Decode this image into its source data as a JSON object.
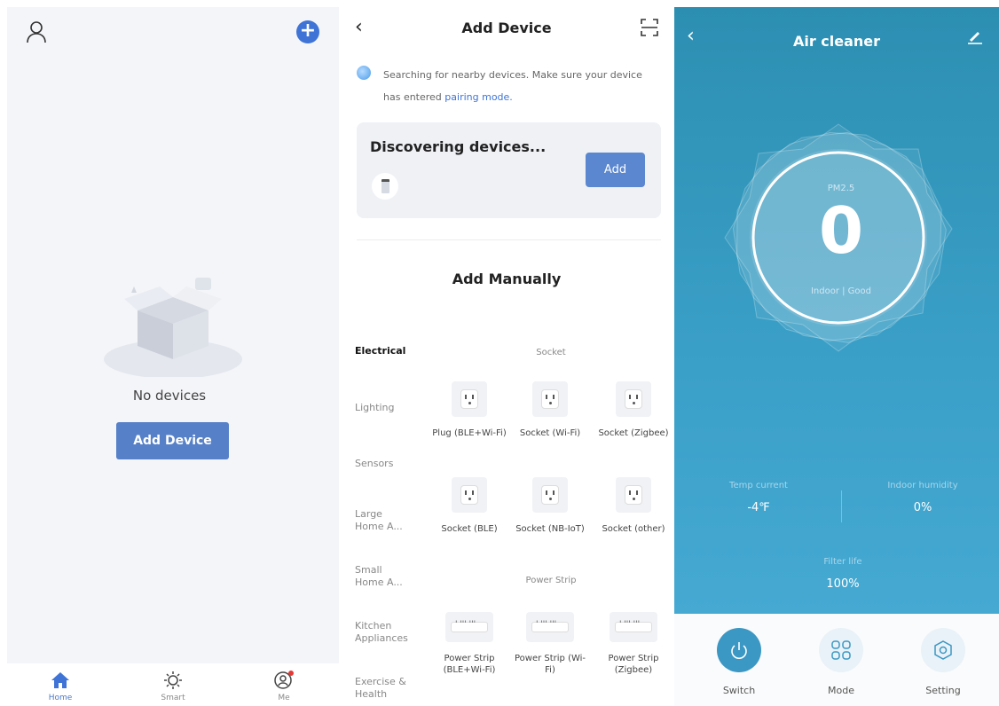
{
  "home": {
    "empty_text": "No devices",
    "add_device_label": "Add Device",
    "tabs": [
      {
        "label": "Home",
        "icon": "home-icon"
      },
      {
        "label": "Smart",
        "icon": "sun-icon"
      },
      {
        "label": "Me",
        "icon": "profile-icon"
      }
    ]
  },
  "add_device": {
    "title": "Add Device",
    "searching_text": "Searching for nearby devices. Make sure your device has entered",
    "pairing_link": "pairing mode.",
    "discovering_title": "Discovering devices...",
    "add_button": "Add",
    "manual_title": "Add Manually",
    "categories": [
      "Electrical",
      "Lighting",
      "Sensors",
      "Large Home A...",
      "Small Home A...",
      "Kitchen Appliances",
      "Exercise & Health"
    ],
    "section_socket": "Socket",
    "section_strip": "Power Strip",
    "items": [
      {
        "name": "Plug (BLE+Wi-Fi)"
      },
      {
        "name": "Socket (Wi-Fi)"
      },
      {
        "name": "Socket (Zigbee)"
      },
      {
        "name": "Socket (BLE)"
      },
      {
        "name": "Socket (NB-IoT)"
      },
      {
        "name": "Socket (other)"
      },
      {
        "name": "Power Strip (BLE+Wi-Fi)"
      },
      {
        "name": "Power Strip (Wi-Fi)"
      },
      {
        "name": "Power Strip (Zigbee)"
      }
    ]
  },
  "air_cleaner": {
    "title": "Air cleaner",
    "pm_label": "PM2.5",
    "pm_value": "0",
    "quality": "Indoor | Good",
    "temp_label": "Temp current",
    "temp_value": "-4℉",
    "humidity_label": "Indoor humidity",
    "humidity_value": "0%",
    "filter_label": "Filter life",
    "filter_value": "100%",
    "controls": [
      {
        "label": "Switch",
        "icon": "power-icon"
      },
      {
        "label": "Mode",
        "icon": "grid-icon"
      },
      {
        "label": "Setting",
        "icon": "settings-icon"
      }
    ],
    "accent": "#3b97c3"
  }
}
